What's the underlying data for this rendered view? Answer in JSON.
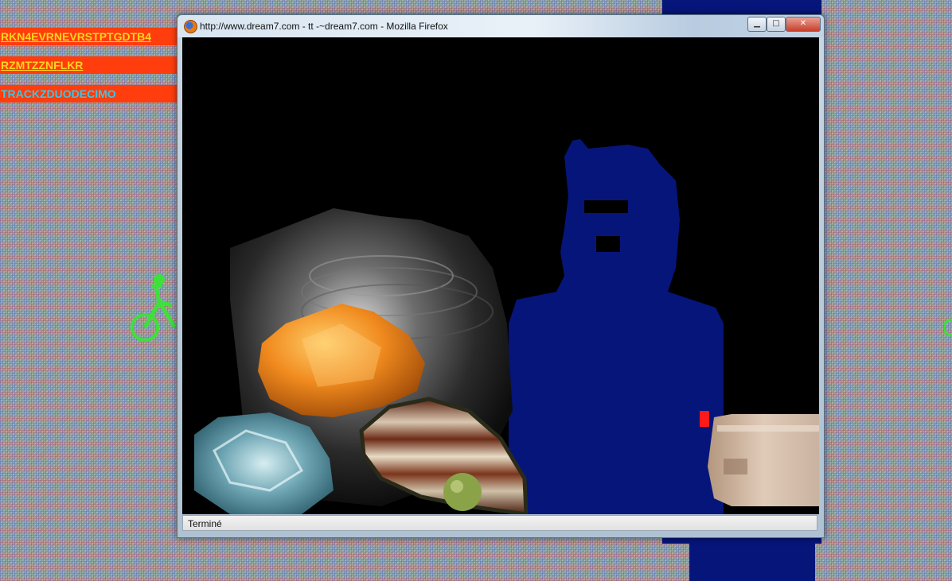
{
  "background_links": [
    {
      "text": "RKN4EVRNEVRSTPTGDTB4",
      "color": "#ffd41e",
      "bg": "#ff3d0d"
    },
    {
      "text": "RZMTZZNFLKR",
      "color": "#ffd41e",
      "bg": "#ff3d0d"
    },
    {
      "text": "TRACKZDUODECIMO",
      "color": "#39c6e6",
      "bg": "#ff3d0d"
    }
  ],
  "window": {
    "title": "http://www.dream7.com - tt -~dream7.com - Mozilla Firefox",
    "buttons": {
      "minimize": "▁",
      "maximize": "□",
      "close": "✕"
    },
    "status_text": "Terminé"
  },
  "icons": [
    "firefox-icon",
    "bicycle-icon"
  ],
  "colors": {
    "navy": "#06157a",
    "link_bar": "#ff3d0d",
    "content_bg": "#000000"
  }
}
